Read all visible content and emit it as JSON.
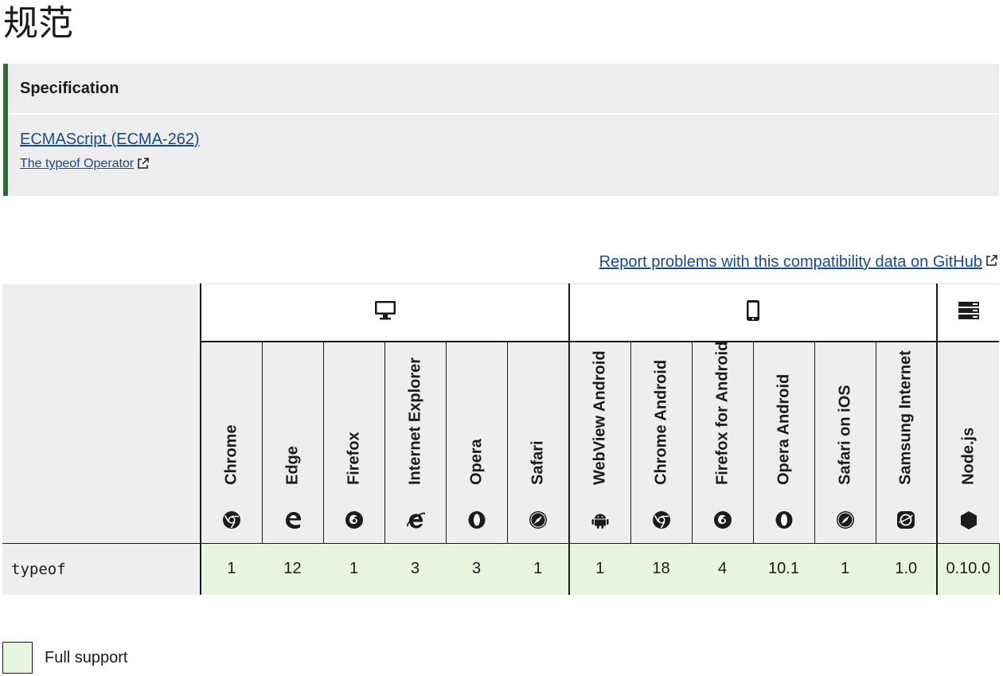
{
  "heading": "规范",
  "spec": {
    "header": "Specification",
    "link": "ECMAScript (ECMA-262)",
    "sublink": "The typeof Operator"
  },
  "report_link": "Report problems with this compatibility data on GitHub",
  "platforms": [
    {
      "icon": "desktop-icon",
      "span": 6
    },
    {
      "icon": "mobile-icon",
      "span": 6
    },
    {
      "icon": "server-icon",
      "span": 1
    }
  ],
  "browsers": [
    {
      "name": "Chrome",
      "icon": "chrome-icon"
    },
    {
      "name": "Edge",
      "icon": "edge-icon"
    },
    {
      "name": "Firefox",
      "icon": "firefox-icon"
    },
    {
      "name": "Internet Explorer",
      "icon": "ie-icon"
    },
    {
      "name": "Opera",
      "icon": "opera-icon"
    },
    {
      "name": "Safari",
      "icon": "safari-icon"
    },
    {
      "name": "WebView Android",
      "icon": "android-icon"
    },
    {
      "name": "Chrome Android",
      "icon": "chrome-icon"
    },
    {
      "name": "Firefox for Android",
      "icon": "firefox-icon"
    },
    {
      "name": "Opera Android",
      "icon": "opera-icon"
    },
    {
      "name": "Safari on iOS",
      "icon": "safari-icon"
    },
    {
      "name": "Samsung Internet",
      "icon": "samsung-icon"
    },
    {
      "name": "Node.js",
      "icon": "nodejs-icon"
    }
  ],
  "row": {
    "feature": "typeof",
    "versions": [
      "1",
      "12",
      "1",
      "3",
      "3",
      "1",
      "1",
      "18",
      "4",
      "10.1",
      "1",
      "1.0",
      "0.10.0"
    ]
  },
  "legend": {
    "label": "Full support"
  },
  "colors": {
    "full_support": "#e9f6df",
    "spec_accent": "#2e6a3c",
    "link": "#1a4a8b"
  }
}
